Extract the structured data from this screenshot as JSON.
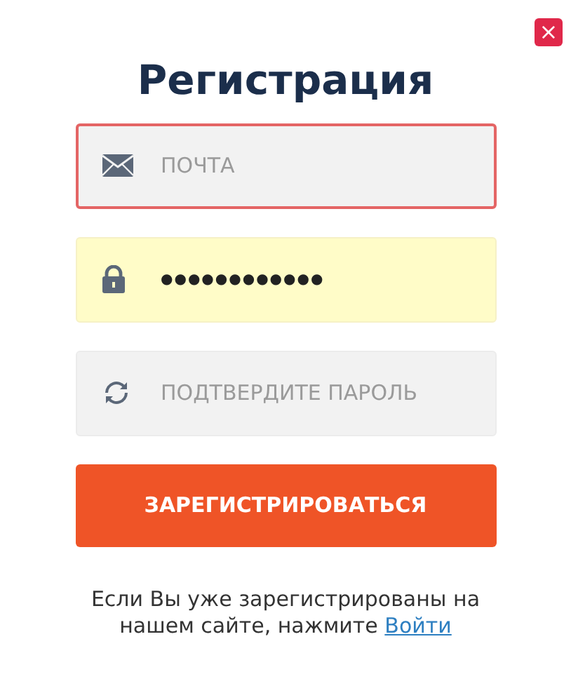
{
  "close_button": {
    "label": "×"
  },
  "title": "Регистрация",
  "fields": [
    {
      "kind": "email",
      "placeholder": "ПОЧТА",
      "invalid": true,
      "autofilled": false
    },
    {
      "kind": "password",
      "value": "●●●●●●●●●●●●",
      "invalid": false,
      "autofilled": true
    },
    {
      "kind": "confirm",
      "placeholder": "ПОДТВЕРДИТЕ ПАРОЛЬ",
      "invalid": false,
      "autofilled": false
    }
  ],
  "submit_button": "ЗАРЕГИСТРИРОВАТЬСЯ",
  "footer": {
    "text": "Если Вы уже зарегистрированы на нашем сайте, нажмите ",
    "link": "Войти"
  }
}
